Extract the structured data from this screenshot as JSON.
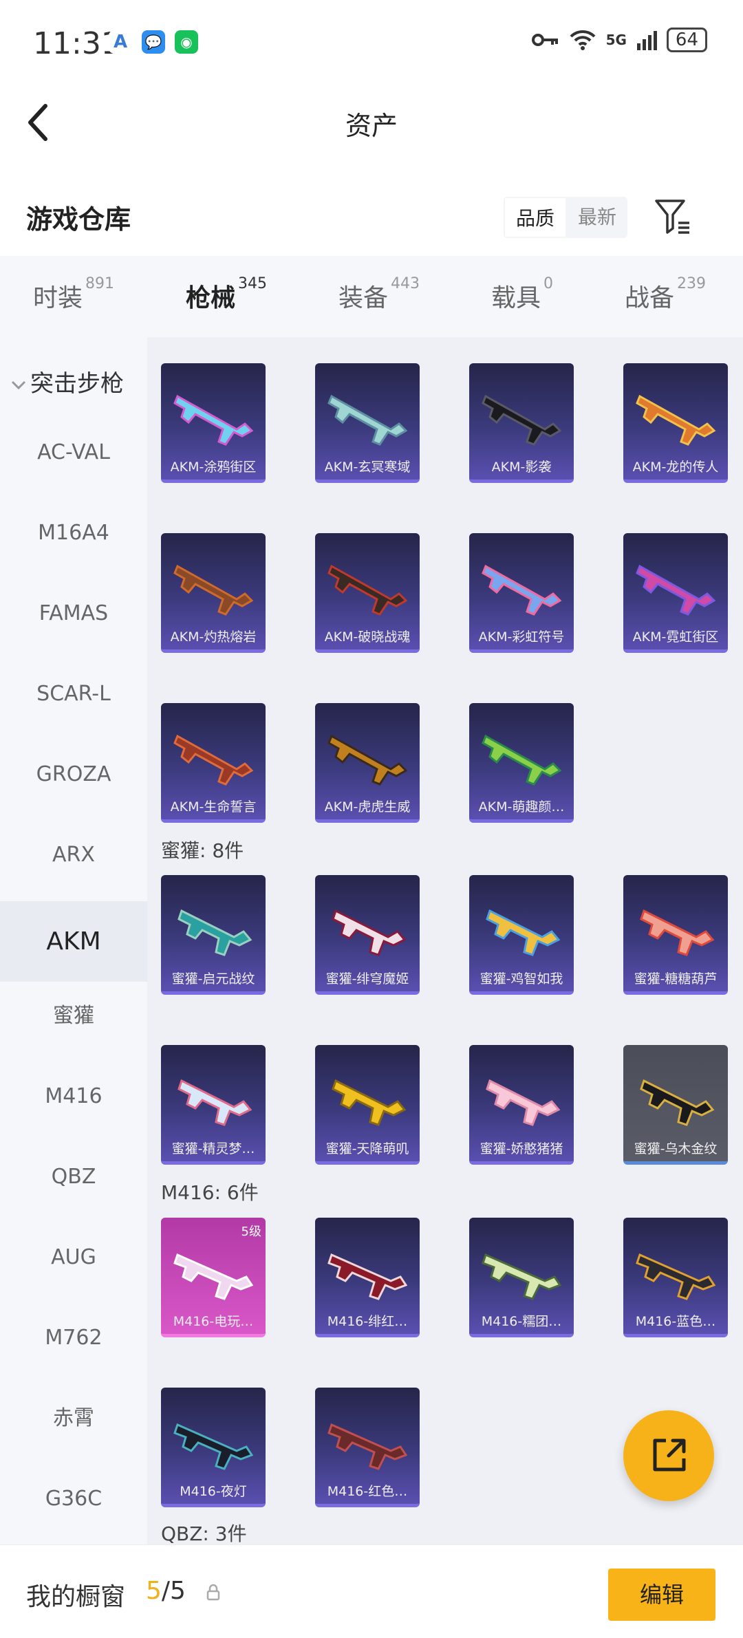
{
  "status": {
    "time": "11:31",
    "network": "5G",
    "battery": "64"
  },
  "header": {
    "title": "资产"
  },
  "warehouse": {
    "title": "游戏仓库",
    "sort_quality": "品质",
    "sort_latest": "最新"
  },
  "tabs": [
    {
      "label": "时装",
      "count": "891"
    },
    {
      "label": "枪械",
      "count": "345"
    },
    {
      "label": "装备",
      "count": "443"
    },
    {
      "label": "载具",
      "count": "0"
    },
    {
      "label": "战备",
      "count": "239"
    }
  ],
  "sidebar": {
    "category": "突击步枪",
    "items": [
      "AC-VAL",
      "M16A4",
      "FAMAS",
      "SCAR-L",
      "GROZA",
      "ARX",
      "AKM",
      "蜜獾",
      "M416",
      "QBZ",
      "AUG",
      "M762",
      "赤霄",
      "G36C"
    ]
  },
  "groups": [
    {
      "header": "",
      "items": [
        "AKM-涂鸦街区",
        "AKM-玄冥寒域",
        "AKM-影袭",
        "AKM-龙的传人",
        "AKM-灼热熔岩",
        "AKM-破晓战魂",
        "AKM-彩虹符号",
        "AKM-霓虹街区",
        "AKM-生命誓言",
        "AKM-虎虎生威",
        "AKM-萌趣颜…"
      ]
    },
    {
      "header": "蜜獾: 8件",
      "items": [
        "蜜獾-启元战纹",
        "蜜獾-绯穹魔姬",
        "蜜獾-鸡智如我",
        "蜜獾-糖糖葫芦",
        "蜜獾-精灵梦…",
        "蜜獾-天降萌叽",
        "蜜獾-娇憨猪猪",
        "蜜獾-乌木金纹"
      ]
    },
    {
      "header": "M416: 6件",
      "items": [
        "M416-电玩…",
        "M416-绯红…",
        "M416-糯团…",
        "M416-蓝色…",
        "M416-夜灯",
        "M416-红色…"
      ]
    }
  ],
  "badge": "5级",
  "qbz_header": "QBZ: 3件",
  "bottom": {
    "label": "我的橱窗",
    "count_current": "5",
    "count_total": "/5",
    "edit": "编辑"
  },
  "colors": {
    "accent": "#f2b01b",
    "card_purple": "#3b3a7c"
  }
}
